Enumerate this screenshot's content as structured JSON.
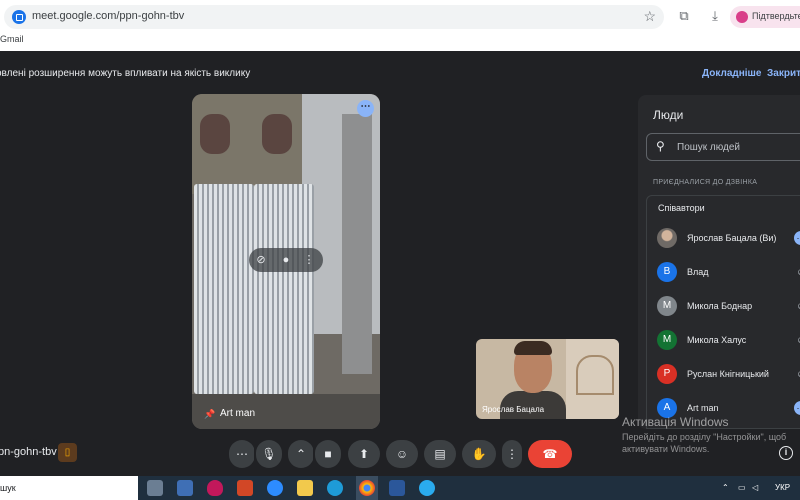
{
  "browser": {
    "url": "meet.google.com/ppn-gohn-tbv",
    "confirm_label": "Підтвердьте св",
    "bookmark": "Gmail"
  },
  "notice": {
    "text": "овлені розширення можуть впливати на якість виклику",
    "details_link": "Докладніше",
    "close_link": "Закрити"
  },
  "main_tile": {
    "name": "Art man"
  },
  "self_view": {
    "name": "Ярослав Бацала"
  },
  "people_panel": {
    "title": "Люди",
    "search_placeholder": "Пошук людей",
    "section_label": "ПРИЄДНАЛИСЯ ДО ДЗВІНКА",
    "group_label": "Співавтори",
    "participants": [
      {
        "name": "Ярослав Бацала (Ви)",
        "initial": "",
        "color": "#6f6a66",
        "action": "more"
      },
      {
        "name": "Влад",
        "initial": "В",
        "color": "#1a73e8",
        "action": "muted"
      },
      {
        "name": "Микола Боднар",
        "initial": "М",
        "color": "#80868b",
        "action": "muted"
      },
      {
        "name": "Микола Халус",
        "initial": "М",
        "color": "#137333",
        "action": "muted"
      },
      {
        "name": "Руслан Кнігницький",
        "initial": "Р",
        "color": "#d93025",
        "action": "muted"
      },
      {
        "name": "Art man",
        "initial": "A",
        "color": "#1a73e8",
        "action": "more"
      }
    ]
  },
  "meeting": {
    "code": "pn-gohn-tbv"
  },
  "watermark": {
    "title": "Активація Windows",
    "subtitle": "Перейдіть до розділу \"Настройки\", щоб активувати Windows."
  },
  "taskbar": {
    "search_text": "шук",
    "language": "УКР"
  },
  "colors": {
    "accent": "#8ab4f8",
    "end_call": "#ea4335",
    "background": "#202124"
  }
}
